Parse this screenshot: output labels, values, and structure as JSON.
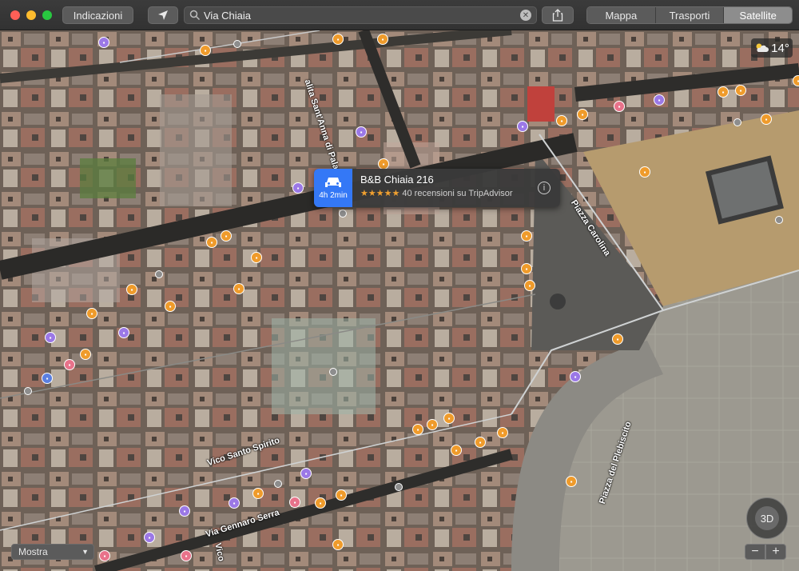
{
  "toolbar": {
    "directions_label": "Indicazioni",
    "search": {
      "value": "Via Chiaia",
      "placeholder": ""
    },
    "view_modes": [
      {
        "label": "Mappa",
        "active": false
      },
      {
        "label": "Trasporti",
        "active": false
      },
      {
        "label": "Satellite",
        "active": true
      }
    ]
  },
  "weather": {
    "temperature": "14°",
    "icon": "partly-cloudy-icon"
  },
  "callout": {
    "eta": "4h 2min",
    "title": "B&B Chiaia 216",
    "stars": "★★★★★",
    "reviews": "40 recensioni su TripAdvisor"
  },
  "map_labels": {
    "salita": "alita Sant'Anna di Palazzo",
    "piazza_carolina": "Piazza Carolina",
    "vico_santo_spirito": "Vico Santo Spirito",
    "via_gennaro_serra": "Via Gennaro Serra",
    "piazza_plebiscito": "Piazza del Plebiscito",
    "vico": "Vico"
  },
  "bottom": {
    "show_label": "Mostra",
    "compass_label": "3D",
    "zoom_out": "−",
    "zoom_in": "+"
  },
  "colors": {
    "accent": "#3478f6",
    "pin_orange": "#ef9b2b",
    "pin_purple": "#9b78e6",
    "star": "#f0a030"
  }
}
